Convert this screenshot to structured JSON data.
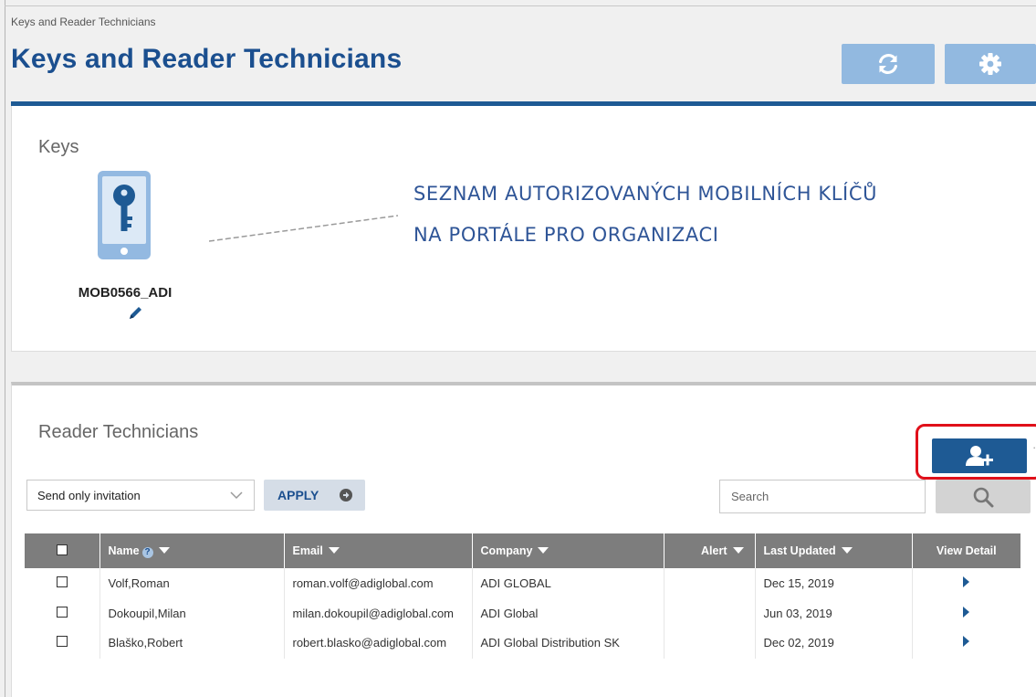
{
  "breadcrumb": "Keys and Reader Technicians",
  "page_title": "Keys and Reader Technicians",
  "header_buttons": [
    {
      "name": "refresh",
      "icon": "refresh-icon"
    },
    {
      "name": "settings",
      "icon": "gear-icon"
    }
  ],
  "keys": {
    "title": "Keys",
    "items": [
      {
        "name": "MOB0566_ADI",
        "icon": "mobile-key-icon"
      }
    ]
  },
  "annotation": {
    "line1": "SEZNAM AUTORIZOVANÝCH MOBILNÍCH KLÍČŮ",
    "line2": "NA PORTÁLE PRO ORGANIZACI"
  },
  "reader_technicians": {
    "title": "Reader Technicians",
    "action_select": {
      "value": "Send only invitation"
    },
    "apply_label": "APPLY",
    "search_placeholder": "Search",
    "columns": [
      "Name",
      "Email",
      "Company",
      "Alert",
      "Last Updated",
      "View Detail"
    ],
    "rows": [
      {
        "name": "Volf,Roman",
        "email": "roman.volf@adiglobal.com",
        "company": "ADI GLOBAL",
        "alert": "",
        "last_updated": "Dec 15, 2019"
      },
      {
        "name": "Dokoupil,Milan",
        "email": "milan.dokoupil@adiglobal.com",
        "company": "ADI Global",
        "alert": "",
        "last_updated": "Jun 03, 2019"
      },
      {
        "name": "Blaško,Robert",
        "email": "robert.blasko@adiglobal.com",
        "company": "ADI Global Distribution SK",
        "alert": "",
        "last_updated": "Dec 02, 2019"
      }
    ]
  },
  "colors": {
    "brand_blue": "#1b4f8f",
    "header_button": "#92b9e0",
    "annotation_text": "#2f5597",
    "highlight_red": "#e0101a",
    "table_header": "#7d7d7d"
  }
}
